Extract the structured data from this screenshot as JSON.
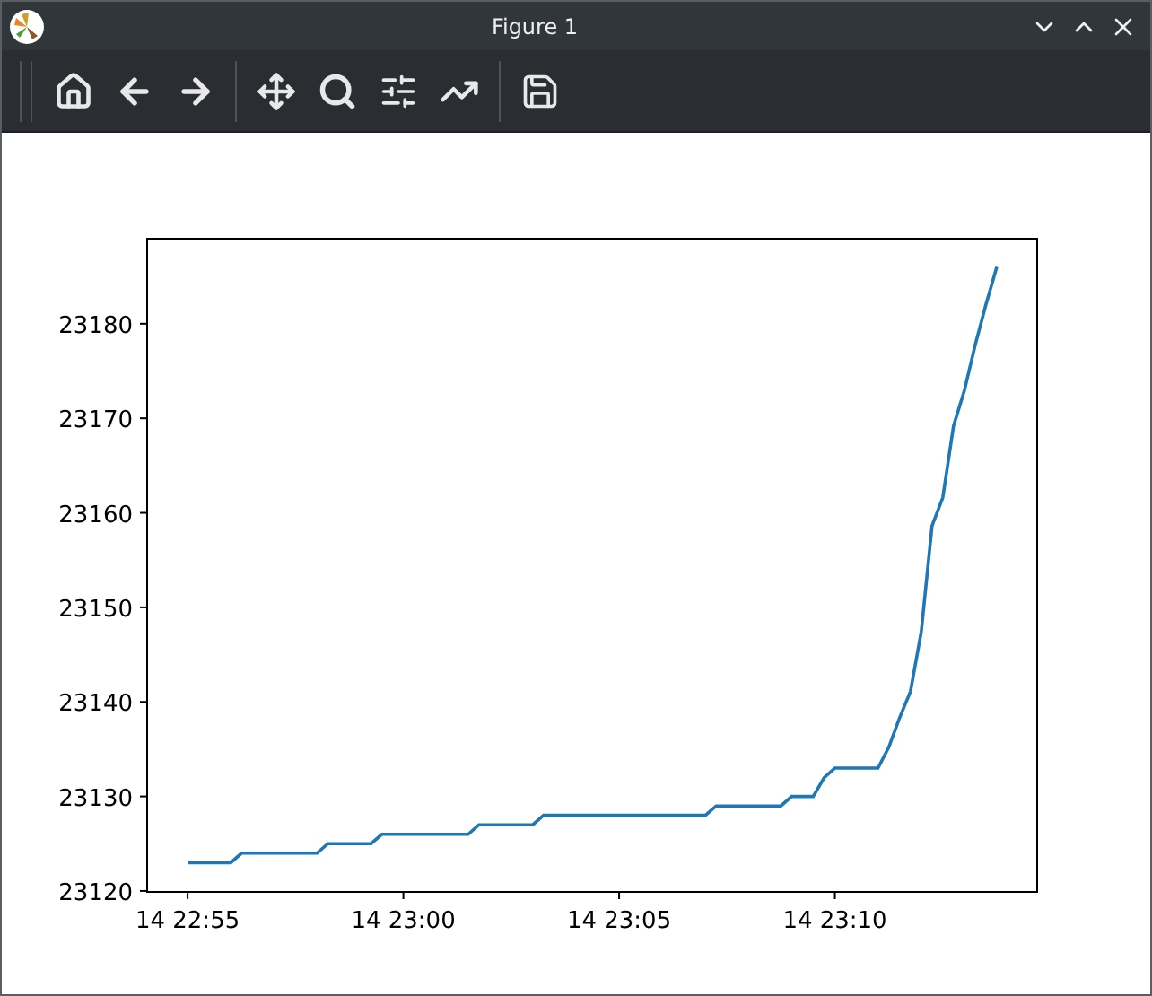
{
  "window": {
    "title": "Figure 1"
  },
  "toolbar": {
    "buttons": [
      {
        "kind": "home"
      },
      {
        "kind": "back"
      },
      {
        "kind": "forward"
      },
      {
        "kind": "sep"
      },
      {
        "kind": "pan"
      },
      {
        "kind": "zoom"
      },
      {
        "kind": "subplots"
      },
      {
        "kind": "lines"
      },
      {
        "kind": "sep"
      },
      {
        "kind": "save"
      }
    ]
  },
  "figure": {
    "chart_data": {
      "type": "line",
      "categories": [
        "14 22:55",
        null,
        null,
        null,
        null,
        null,
        null,
        null,
        null,
        null,
        null,
        null,
        null,
        null,
        null,
        null,
        null,
        null,
        null,
        null,
        "14 23:00",
        null,
        null,
        null,
        null,
        null,
        null,
        null,
        null,
        null,
        null,
        null,
        null,
        null,
        null,
        null,
        null,
        null,
        null,
        null,
        "14 23:05",
        null,
        null,
        null,
        null,
        null,
        null,
        null,
        null,
        null,
        null,
        null,
        null,
        null,
        null,
        null,
        null,
        null,
        null,
        null,
        "14 23:10",
        null,
        null,
        null,
        null,
        null,
        null,
        null,
        null,
        null,
        null,
        null,
        null,
        null,
        null,
        null
      ],
      "series": [
        {
          "color": "#1f77b4",
          "values": [
            23123,
            23123,
            23123,
            23123,
            23123,
            23124,
            23124,
            23124,
            23124,
            23124,
            23124,
            23124,
            23124,
            23125,
            23125,
            23125,
            23125,
            23125,
            23126,
            23126,
            23126,
            23126,
            23126,
            23126,
            23126,
            23126,
            23126,
            23127,
            23127,
            23127,
            23127,
            23127,
            23127,
            23128,
            23128,
            23128,
            23128,
            23128,
            23128,
            23128,
            23128,
            23128,
            23128,
            23128,
            23128,
            23128,
            23128,
            23128,
            23128,
            23129,
            23129,
            23129,
            23129,
            23129,
            23129,
            23129,
            23130,
            23130,
            23130,
            23132,
            23133,
            23133,
            23133,
            23133,
            23133,
            23135.2,
            23138.3,
            23141.1,
            23147.4,
            23158.6,
            23161.6,
            23169.2,
            23172.9,
            23177.7,
            23182,
            23186
          ]
        }
      ],
      "ylim": [
        23119.9,
        23189
      ],
      "yticks": [
        23120,
        23130,
        23140,
        23150,
        23160,
        23170,
        23180
      ]
    }
  }
}
